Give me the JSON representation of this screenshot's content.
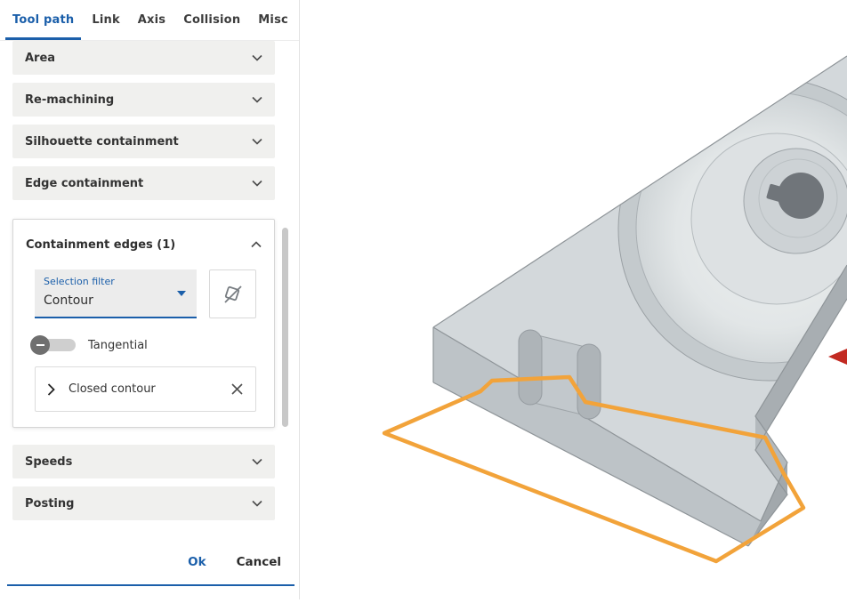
{
  "colors": {
    "accent": "#1b5faa",
    "selection_contour": "#f2a33a",
    "model_gray": "#c8cdd1"
  },
  "tabs": {
    "items": [
      {
        "label": "Tool path",
        "active": true
      },
      {
        "label": "Link",
        "active": false
      },
      {
        "label": "Axis",
        "active": false
      },
      {
        "label": "Collision",
        "active": false
      },
      {
        "label": "Misc",
        "active": false
      }
    ]
  },
  "sections_top": [
    {
      "label": "Area"
    },
    {
      "label": "Re-machining"
    },
    {
      "label": "Silhouette containment"
    },
    {
      "label": "Edge containment"
    }
  ],
  "containment_card": {
    "title": "Containment edges (1)",
    "selection_filter": {
      "label": "Selection filter",
      "value": "Contour"
    },
    "tangential_label": "Tangential",
    "contour_item": {
      "label": "Closed contour"
    }
  },
  "sections_bottom": [
    {
      "label": "Speeds"
    },
    {
      "label": "Posting"
    }
  ],
  "footer": {
    "ok_label": "Ok",
    "cancel_label": "Cancel"
  },
  "icons": {
    "chevron_down": "⌄",
    "chevron_up": "⌃",
    "chevron_right": "›",
    "close": "✕",
    "dropdown_caret": "▾",
    "toggle_off_dash": "–",
    "clear_selection": "crossed-selection glyph",
    "axis_arrow": "red arrowhead"
  }
}
